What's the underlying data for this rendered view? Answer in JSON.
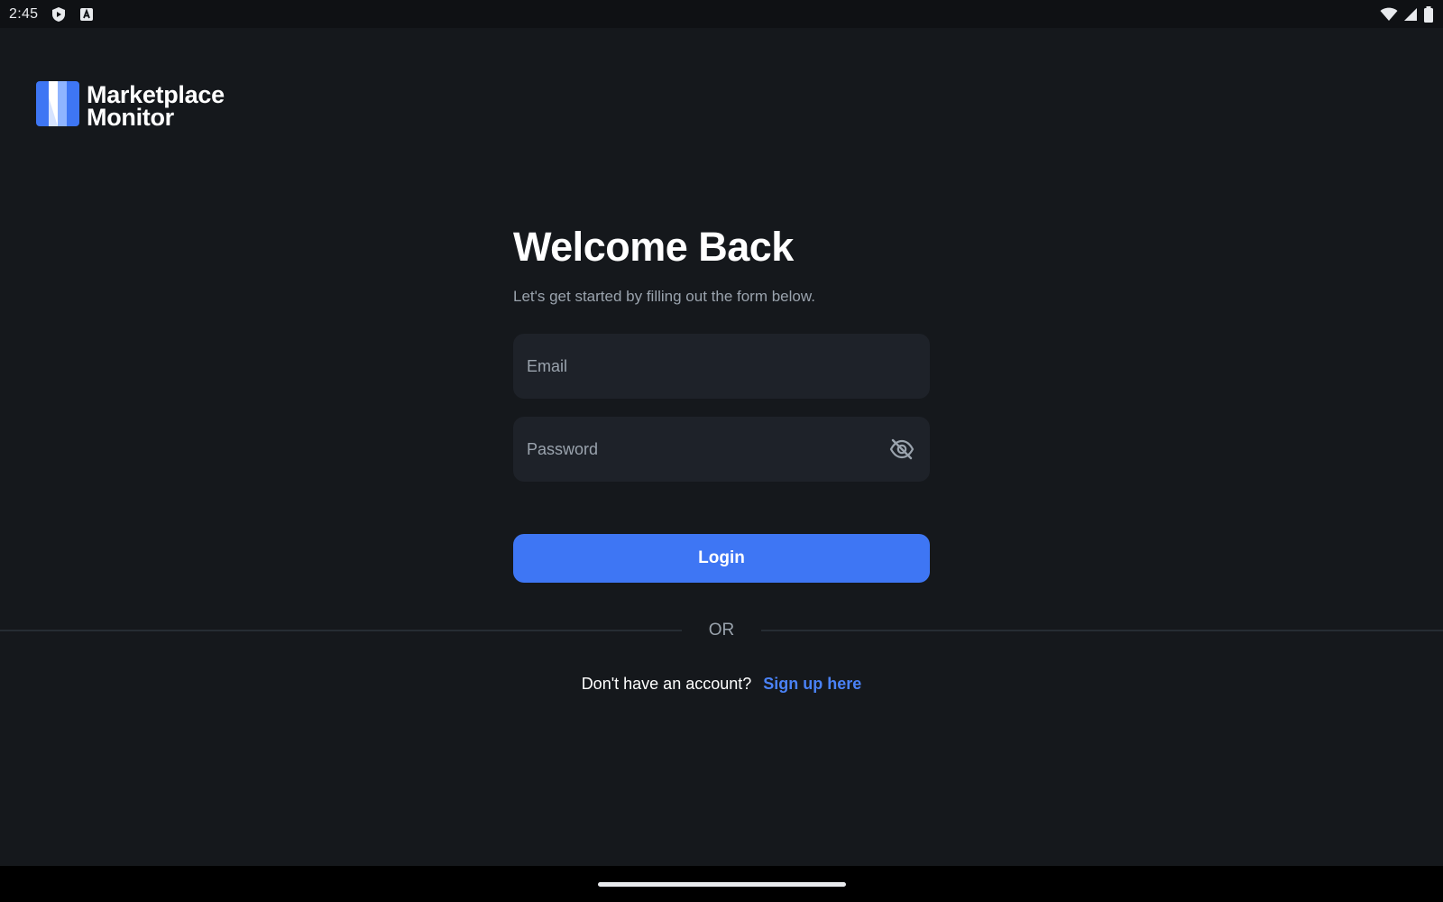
{
  "status_bar": {
    "time": "2:45",
    "left_icons": [
      "play-protect-icon",
      "app-notification-icon"
    ],
    "right_icons": [
      "wifi-icon",
      "cell-signal-icon",
      "battery-icon"
    ]
  },
  "logo": {
    "line1": "Marketplace",
    "line2": "Monitor",
    "colors": {
      "dark_blue": "#3e76f4",
      "light_blue": "#8fb4ff",
      "white": "#ffffff"
    }
  },
  "form": {
    "title": "Welcome Back",
    "subtitle": "Let's get started by filling out the form below.",
    "email": {
      "placeholder": "Email",
      "value": ""
    },
    "password": {
      "placeholder": "Password",
      "value": "",
      "toggle_icon": "eye-off-icon"
    },
    "login_label": "Login"
  },
  "divider": {
    "label": "OR"
  },
  "signup": {
    "prompt": "Don't have an account?",
    "link_label": "Sign up here"
  },
  "theme": {
    "background": "#15181c",
    "field_background": "#1e2229",
    "accent": "#3e76f4",
    "link": "#4a82f7",
    "muted_text": "#9aa3ad"
  }
}
